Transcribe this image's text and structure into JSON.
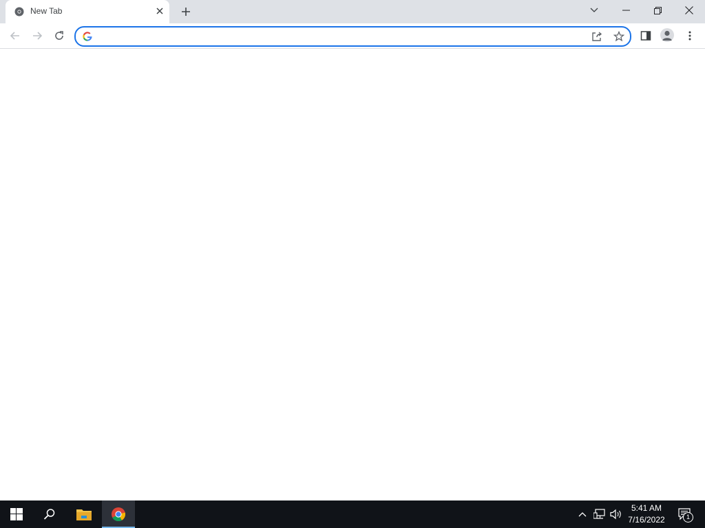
{
  "tab": {
    "title": "New Tab"
  },
  "omnibox": {
    "value": "",
    "placeholder": ""
  },
  "taskbar": {
    "time": "5:41 AM",
    "date": "7/16/2022",
    "notification_count": "1"
  },
  "colors": {
    "accent": "#1a73e8",
    "tabstrip": "#dee1e6",
    "taskbar": "#101318"
  }
}
